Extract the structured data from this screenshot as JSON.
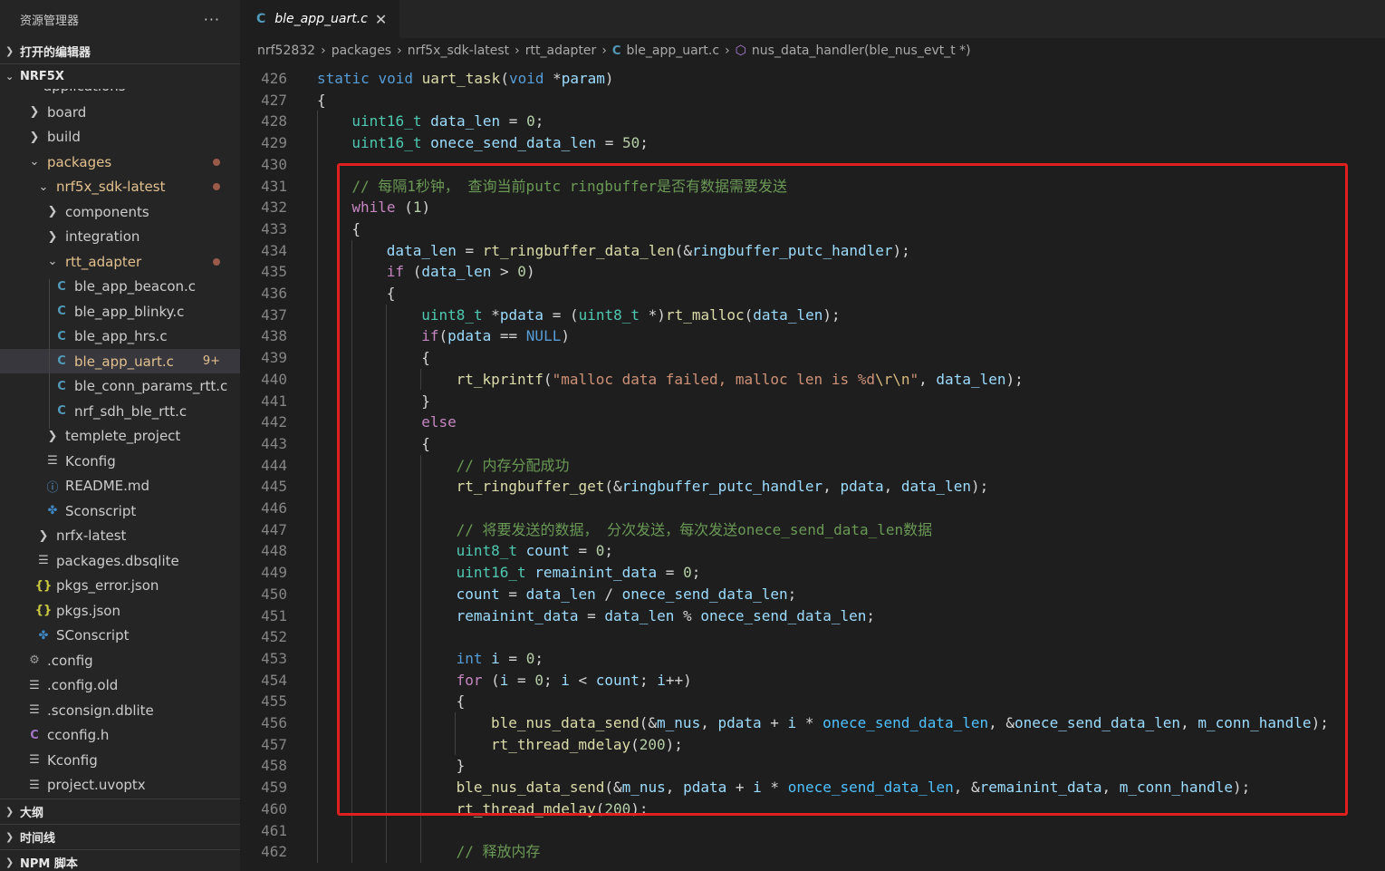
{
  "sidebar": {
    "title": "资源管理器",
    "more_label": "···",
    "open_editors_label": "打开的编辑器",
    "folder_label": "NRF5X",
    "partial_item": "applications",
    "items": [
      {
        "label": "board",
        "kind": "folder",
        "depth": 1
      },
      {
        "label": "build",
        "kind": "folder",
        "depth": 1
      },
      {
        "label": "packages",
        "kind": "folder-open",
        "depth": 1,
        "modified": true
      },
      {
        "label": "nrf5x_sdk-latest",
        "kind": "folder-open",
        "depth": 2,
        "modified": true
      },
      {
        "label": "components",
        "kind": "folder",
        "depth": 3
      },
      {
        "label": "integration",
        "kind": "folder",
        "depth": 3
      },
      {
        "label": "rtt_adapter",
        "kind": "folder-open",
        "depth": 3,
        "modified": true
      },
      {
        "label": "ble_app_beacon.c",
        "kind": "c",
        "depth": 4
      },
      {
        "label": "ble_app_blinky.c",
        "kind": "c",
        "depth": 4
      },
      {
        "label": "ble_app_hrs.c",
        "kind": "c",
        "depth": 4
      },
      {
        "label": "ble_app_uart.c",
        "kind": "c",
        "depth": 4,
        "selected": true,
        "badge": "9+"
      },
      {
        "label": "ble_conn_params_rtt.c",
        "kind": "c",
        "depth": 4
      },
      {
        "label": "nrf_sdh_ble_rtt.c",
        "kind": "c",
        "depth": 4
      },
      {
        "label": "templete_project",
        "kind": "folder",
        "depth": 3
      },
      {
        "label": "Kconfig",
        "kind": "lines",
        "depth": 3
      },
      {
        "label": "README.md",
        "kind": "info",
        "depth": 3
      },
      {
        "label": "Sconscript",
        "kind": "python",
        "depth": 3
      },
      {
        "label": "nrfx-latest",
        "kind": "folder",
        "depth": 2
      },
      {
        "label": "packages.dbsqlite",
        "kind": "lines",
        "depth": 2
      },
      {
        "label": "pkgs_error.json",
        "kind": "json",
        "depth": 2
      },
      {
        "label": "pkgs.json",
        "kind": "json",
        "depth": 2
      },
      {
        "label": "SConscript",
        "kind": "python",
        "depth": 2
      },
      {
        "label": ".config",
        "kind": "gear",
        "depth": 1
      },
      {
        "label": ".config.old",
        "kind": "lines",
        "depth": 1
      },
      {
        "label": ".sconsign.dblite",
        "kind": "lines",
        "depth": 1
      },
      {
        "label": "cconfig.h",
        "kind": "c-purple",
        "depth": 1
      },
      {
        "label": "Kconfig",
        "kind": "lines",
        "depth": 1
      },
      {
        "label": "project.uvoptx",
        "kind": "lines",
        "depth": 1
      }
    ],
    "bottom_sections": [
      "大纲",
      "时间线",
      "NPM 脚本"
    ]
  },
  "tab": {
    "icon": "C",
    "name": "ble_app_uart.c",
    "close": "✕"
  },
  "breadcrumb": {
    "parts": [
      "nrf52832",
      "packages",
      "nrf5x_sdk-latest",
      "rtt_adapter"
    ],
    "file_icon": "C",
    "file": "ble_app_uart.c",
    "symbol": "nus_data_handler(ble_nus_evt_t *)"
  },
  "colors": {
    "kw": "#569cd6",
    "type": "#4ec9b0",
    "fn": "#dcdcaa",
    "var": "#9cdcfe",
    "num": "#b5cea8",
    "str": "#ce9178",
    "esc": "#d7ba7d",
    "comment": "#6a9955",
    "ctrl": "#c586c0",
    "const": "#4fc1ff",
    "highlight_box": "#e0201f"
  },
  "code": [
    {
      "n": "426",
      "indent": 0,
      "tokens": [
        [
          "kw",
          "static"
        ],
        [
          "pl",
          " "
        ],
        [
          "kw",
          "void"
        ],
        [
          "pl",
          " "
        ],
        [
          "fn",
          "uart_task"
        ],
        [
          "pl",
          "("
        ],
        [
          "kw",
          "void"
        ],
        [
          "pl",
          " *"
        ],
        [
          "va",
          "param"
        ],
        [
          "pl",
          ")"
        ]
      ]
    },
    {
      "n": "427",
      "indent": 0,
      "tokens": [
        [
          "pl",
          "{"
        ]
      ]
    },
    {
      "n": "428",
      "indent": 1,
      "tokens": [
        [
          "ty",
          "uint16_t"
        ],
        [
          "pl",
          " "
        ],
        [
          "va",
          "data_len"
        ],
        [
          "pl",
          " = "
        ],
        [
          "nu",
          "0"
        ],
        [
          "pl",
          ";"
        ]
      ]
    },
    {
      "n": "429",
      "indent": 1,
      "tokens": [
        [
          "ty",
          "uint16_t"
        ],
        [
          "pl",
          " "
        ],
        [
          "va",
          "onece_send_data_len"
        ],
        [
          "pl",
          " = "
        ],
        [
          "nu",
          "50"
        ],
        [
          "pl",
          ";"
        ]
      ]
    },
    {
      "n": "430",
      "indent": 0,
      "tokens": []
    },
    {
      "n": "431",
      "indent": 1,
      "tokens": [
        [
          "co",
          "// 每隔1秒钟， 查询当前putc ringbuffer是否有数据需要发送"
        ]
      ]
    },
    {
      "n": "432",
      "indent": 1,
      "tokens": [
        [
          "ctrl",
          "while"
        ],
        [
          "pl",
          " ("
        ],
        [
          "nu",
          "1"
        ],
        [
          "pl",
          ")"
        ]
      ]
    },
    {
      "n": "433",
      "indent": 1,
      "tokens": [
        [
          "pl",
          "{"
        ]
      ]
    },
    {
      "n": "434",
      "indent": 2,
      "tokens": [
        [
          "va",
          "data_len"
        ],
        [
          "pl",
          " = "
        ],
        [
          "fn",
          "rt_ringbuffer_data_len"
        ],
        [
          "pl",
          "(&"
        ],
        [
          "va",
          "ringbuffer_putc_handler"
        ],
        [
          "pl",
          ");"
        ]
      ]
    },
    {
      "n": "435",
      "indent": 2,
      "tokens": [
        [
          "ctrl",
          "if"
        ],
        [
          "pl",
          " ("
        ],
        [
          "va",
          "data_len"
        ],
        [
          "pl",
          " > "
        ],
        [
          "nu",
          "0"
        ],
        [
          "pl",
          ")"
        ]
      ]
    },
    {
      "n": "436",
      "indent": 2,
      "tokens": [
        [
          "pl",
          "{"
        ]
      ]
    },
    {
      "n": "437",
      "indent": 3,
      "tokens": [
        [
          "ty",
          "uint8_t"
        ],
        [
          "pl",
          " *"
        ],
        [
          "va",
          "pdata"
        ],
        [
          "pl",
          " = ("
        ],
        [
          "ty",
          "uint8_t"
        ],
        [
          "pl",
          " *)"
        ],
        [
          "fn",
          "rt_malloc"
        ],
        [
          "pl",
          "("
        ],
        [
          "va",
          "data_len"
        ],
        [
          "pl",
          ");"
        ]
      ]
    },
    {
      "n": "438",
      "indent": 3,
      "tokens": [
        [
          "ctrl",
          "if"
        ],
        [
          "pl",
          "("
        ],
        [
          "va",
          "pdata"
        ],
        [
          "pl",
          " == "
        ],
        [
          "kw",
          "NULL"
        ],
        [
          "pl",
          ")"
        ]
      ]
    },
    {
      "n": "439",
      "indent": 3,
      "tokens": [
        [
          "pl",
          "{"
        ]
      ]
    },
    {
      "n": "440",
      "indent": 4,
      "tokens": [
        [
          "fn",
          "rt_kprintf"
        ],
        [
          "pl",
          "("
        ],
        [
          "st",
          "\"malloc data failed, malloc len is %d"
        ],
        [
          "es",
          "\\r\\n"
        ],
        [
          "st",
          "\""
        ],
        [
          "pl",
          ", "
        ],
        [
          "va",
          "data_len"
        ],
        [
          "pl",
          ");"
        ]
      ]
    },
    {
      "n": "441",
      "indent": 3,
      "tokens": [
        [
          "pl",
          "}"
        ]
      ]
    },
    {
      "n": "442",
      "indent": 3,
      "tokens": [
        [
          "ctrl",
          "else"
        ]
      ]
    },
    {
      "n": "443",
      "indent": 3,
      "tokens": [
        [
          "pl",
          "{"
        ]
      ]
    },
    {
      "n": "444",
      "indent": 4,
      "tokens": [
        [
          "co",
          "// 内存分配成功"
        ]
      ]
    },
    {
      "n": "445",
      "indent": 4,
      "tokens": [
        [
          "fn",
          "rt_ringbuffer_get"
        ],
        [
          "pl",
          "(&"
        ],
        [
          "va",
          "ringbuffer_putc_handler"
        ],
        [
          "pl",
          ", "
        ],
        [
          "va",
          "pdata"
        ],
        [
          "pl",
          ", "
        ],
        [
          "va",
          "data_len"
        ],
        [
          "pl",
          ");"
        ]
      ]
    },
    {
      "n": "446",
      "indent": 0,
      "tokens": []
    },
    {
      "n": "447",
      "indent": 4,
      "tokens": [
        [
          "co",
          "// 将要发送的数据， 分次发送，每次发送onece_send_data_len数据"
        ]
      ]
    },
    {
      "n": "448",
      "indent": 4,
      "tokens": [
        [
          "ty",
          "uint8_t"
        ],
        [
          "pl",
          " "
        ],
        [
          "va",
          "count"
        ],
        [
          "pl",
          " = "
        ],
        [
          "nu",
          "0"
        ],
        [
          "pl",
          ";"
        ]
      ]
    },
    {
      "n": "449",
      "indent": 4,
      "tokens": [
        [
          "ty",
          "uint16_t"
        ],
        [
          "pl",
          " "
        ],
        [
          "va",
          "remainint_data"
        ],
        [
          "pl",
          " = "
        ],
        [
          "nu",
          "0"
        ],
        [
          "pl",
          ";"
        ]
      ]
    },
    {
      "n": "450",
      "indent": 4,
      "tokens": [
        [
          "va",
          "count"
        ],
        [
          "pl",
          " = "
        ],
        [
          "va",
          "data_len"
        ],
        [
          "pl",
          " / "
        ],
        [
          "va",
          "onece_send_data_len"
        ],
        [
          "pl",
          ";"
        ]
      ]
    },
    {
      "n": "451",
      "indent": 4,
      "tokens": [
        [
          "va",
          "remainint_data"
        ],
        [
          "pl",
          " = "
        ],
        [
          "va",
          "data_len"
        ],
        [
          "pl",
          " % "
        ],
        [
          "va",
          "onece_send_data_len"
        ],
        [
          "pl",
          ";"
        ]
      ]
    },
    {
      "n": "452",
      "indent": 0,
      "tokens": []
    },
    {
      "n": "453",
      "indent": 4,
      "tokens": [
        [
          "kw",
          "int"
        ],
        [
          "pl",
          " "
        ],
        [
          "va",
          "i"
        ],
        [
          "pl",
          " = "
        ],
        [
          "nu",
          "0"
        ],
        [
          "pl",
          ";"
        ]
      ]
    },
    {
      "n": "454",
      "indent": 4,
      "tokens": [
        [
          "ctrl",
          "for"
        ],
        [
          "pl",
          " ("
        ],
        [
          "va",
          "i"
        ],
        [
          "pl",
          " = "
        ],
        [
          "nu",
          "0"
        ],
        [
          "pl",
          "; "
        ],
        [
          "va",
          "i"
        ],
        [
          "pl",
          " < "
        ],
        [
          "va",
          "count"
        ],
        [
          "pl",
          "; "
        ],
        [
          "va",
          "i"
        ],
        [
          "pl",
          "++)"
        ]
      ]
    },
    {
      "n": "455",
      "indent": 4,
      "tokens": [
        [
          "pl",
          "{"
        ]
      ]
    },
    {
      "n": "456",
      "indent": 5,
      "tokens": [
        [
          "fn",
          "ble_nus_data_send"
        ],
        [
          "pl",
          "(&"
        ],
        [
          "va",
          "m_nus"
        ],
        [
          "pl",
          ", "
        ],
        [
          "va",
          "pdata"
        ],
        [
          "pl",
          " + "
        ],
        [
          "va",
          "i"
        ],
        [
          "pl",
          " * "
        ],
        [
          "cn",
          "onece_send_data_len"
        ],
        [
          "pl",
          ", &"
        ],
        [
          "va",
          "onece_send_data_len"
        ],
        [
          "pl",
          ", "
        ],
        [
          "va",
          "m_conn_handle"
        ],
        [
          "pl",
          ");"
        ]
      ]
    },
    {
      "n": "457",
      "indent": 5,
      "tokens": [
        [
          "fn",
          "rt_thread_mdelay"
        ],
        [
          "pl",
          "("
        ],
        [
          "nu",
          "200"
        ],
        [
          "pl",
          ");"
        ]
      ]
    },
    {
      "n": "458",
      "indent": 4,
      "tokens": [
        [
          "pl",
          "}"
        ]
      ]
    },
    {
      "n": "459",
      "indent": 4,
      "tokens": [
        [
          "fn",
          "ble_nus_data_send"
        ],
        [
          "pl",
          "(&"
        ],
        [
          "va",
          "m_nus"
        ],
        [
          "pl",
          ", "
        ],
        [
          "va",
          "pdata"
        ],
        [
          "pl",
          " + "
        ],
        [
          "va",
          "i"
        ],
        [
          "pl",
          " * "
        ],
        [
          "cn",
          "onece_send_data_len"
        ],
        [
          "pl",
          ", &"
        ],
        [
          "va",
          "remainint_data"
        ],
        [
          "pl",
          ", "
        ],
        [
          "va",
          "m_conn_handle"
        ],
        [
          "pl",
          ");"
        ]
      ]
    },
    {
      "n": "460",
      "indent": 4,
      "tokens": [
        [
          "fn",
          "rt_thread_mdelay"
        ],
        [
          "pl",
          "("
        ],
        [
          "nu",
          "200"
        ],
        [
          "pl",
          ");"
        ]
      ]
    },
    {
      "n": "461",
      "indent": 0,
      "tokens": []
    },
    {
      "n": "462",
      "indent": 4,
      "tokens": [
        [
          "co",
          "// 释放内存"
        ]
      ]
    }
  ]
}
